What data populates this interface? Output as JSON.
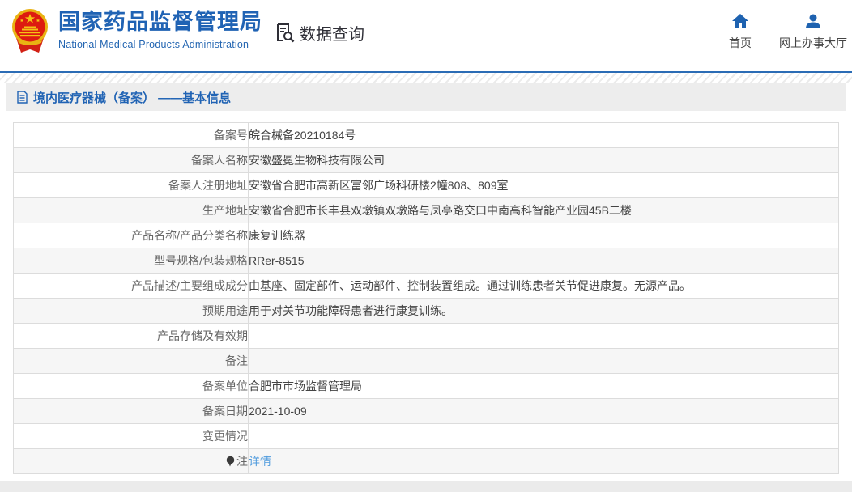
{
  "header": {
    "title_cn": "国家药品监督管理局",
    "title_en": "National Medical Products Administration",
    "query_label": "数据查询",
    "nav": [
      {
        "label": "首页",
        "icon": "home-icon"
      },
      {
        "label": "网上办事大厅",
        "icon": "user-icon"
      }
    ]
  },
  "breadcrumb": {
    "title": "境内医疗器械（备案） ——基本信息",
    "icon": "document-icon"
  },
  "colors": {
    "brand_blue": "#2063b4",
    "line_blue": "#2b6cb5",
    "link_blue": "#4f9bdd"
  },
  "table": {
    "rows": [
      {
        "label": "备案号",
        "value": "皖合械备20210184号"
      },
      {
        "label": "备案人名称",
        "value": "安徽盛冕生物科技有限公司"
      },
      {
        "label": "备案人注册地址",
        "value": "安徽省合肥市高新区富邻广场科研楼2幢808、809室"
      },
      {
        "label": "生产地址",
        "value": "安徽省合肥市长丰县双墩镇双墩路与凤亭路交口中南高科智能产业园45B二楼"
      },
      {
        "label": "产品名称/产品分类名称",
        "value": "康复训练器"
      },
      {
        "label": "型号规格/包装规格",
        "value": "RRer-8515"
      },
      {
        "label": "产品描述/主要组成成分",
        "value": "由基座、固定部件、运动部件、控制装置组成。通过训练患者关节促进康复。无源产品。"
      },
      {
        "label": "预期用途",
        "value": "用于对关节功能障碍患者进行康复训练。"
      },
      {
        "label": "产品存储及有效期",
        "value": ""
      },
      {
        "label": "备注",
        "value": ""
      },
      {
        "label": "备案单位",
        "value": "合肥市市场监督管理局"
      },
      {
        "label": "备案日期",
        "value": "2021-10-09"
      },
      {
        "label": "变更情况",
        "value": ""
      },
      {
        "label": "注",
        "value": "详情",
        "label_icon": "bulb-icon",
        "value_is_link": true
      }
    ]
  }
}
